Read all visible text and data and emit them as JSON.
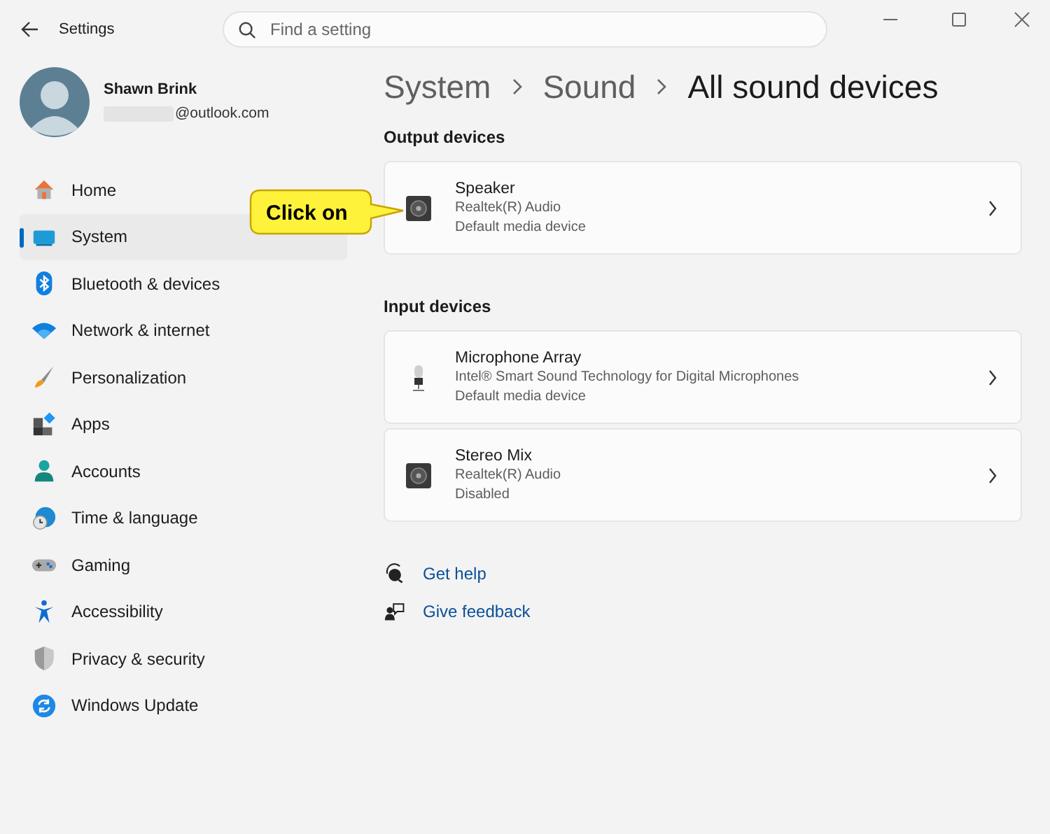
{
  "window": {
    "title": "Settings"
  },
  "search": {
    "placeholder": "Find a setting"
  },
  "profile": {
    "name": "Shawn Brink",
    "email": "@outlook.com"
  },
  "nav": [
    {
      "label": "Home",
      "selected": false
    },
    {
      "label": "System",
      "selected": true
    },
    {
      "label": "Bluetooth & devices",
      "selected": false
    },
    {
      "label": "Network & internet",
      "selected": false
    },
    {
      "label": "Personalization",
      "selected": false
    },
    {
      "label": "Apps",
      "selected": false
    },
    {
      "label": "Accounts",
      "selected": false
    },
    {
      "label": "Time & language",
      "selected": false
    },
    {
      "label": "Gaming",
      "selected": false
    },
    {
      "label": "Accessibility",
      "selected": false
    },
    {
      "label": "Privacy & security",
      "selected": false
    },
    {
      "label": "Windows Update",
      "selected": false
    }
  ],
  "breadcrumb": [
    "System",
    "Sound",
    "All sound devices"
  ],
  "sections": [
    {
      "heading": "Output devices",
      "devices": [
        {
          "kind": "speaker",
          "name": "Speaker",
          "driver": "Realtek(R) Audio",
          "status": "Default media device"
        }
      ]
    },
    {
      "heading": "Input devices",
      "devices": [
        {
          "kind": "microphone",
          "name": "Microphone Array",
          "driver": "Intel® Smart Sound Technology for Digital Microphones",
          "status": "Default media device"
        },
        {
          "kind": "speaker",
          "name": "Stereo Mix",
          "driver": "Realtek(R) Audio",
          "status": "Disabled"
        }
      ]
    }
  ],
  "links": [
    {
      "kind": "help",
      "label": "Get help"
    },
    {
      "kind": "feedback",
      "label": "Give feedback"
    }
  ],
  "callout": {
    "text": "Click on"
  }
}
